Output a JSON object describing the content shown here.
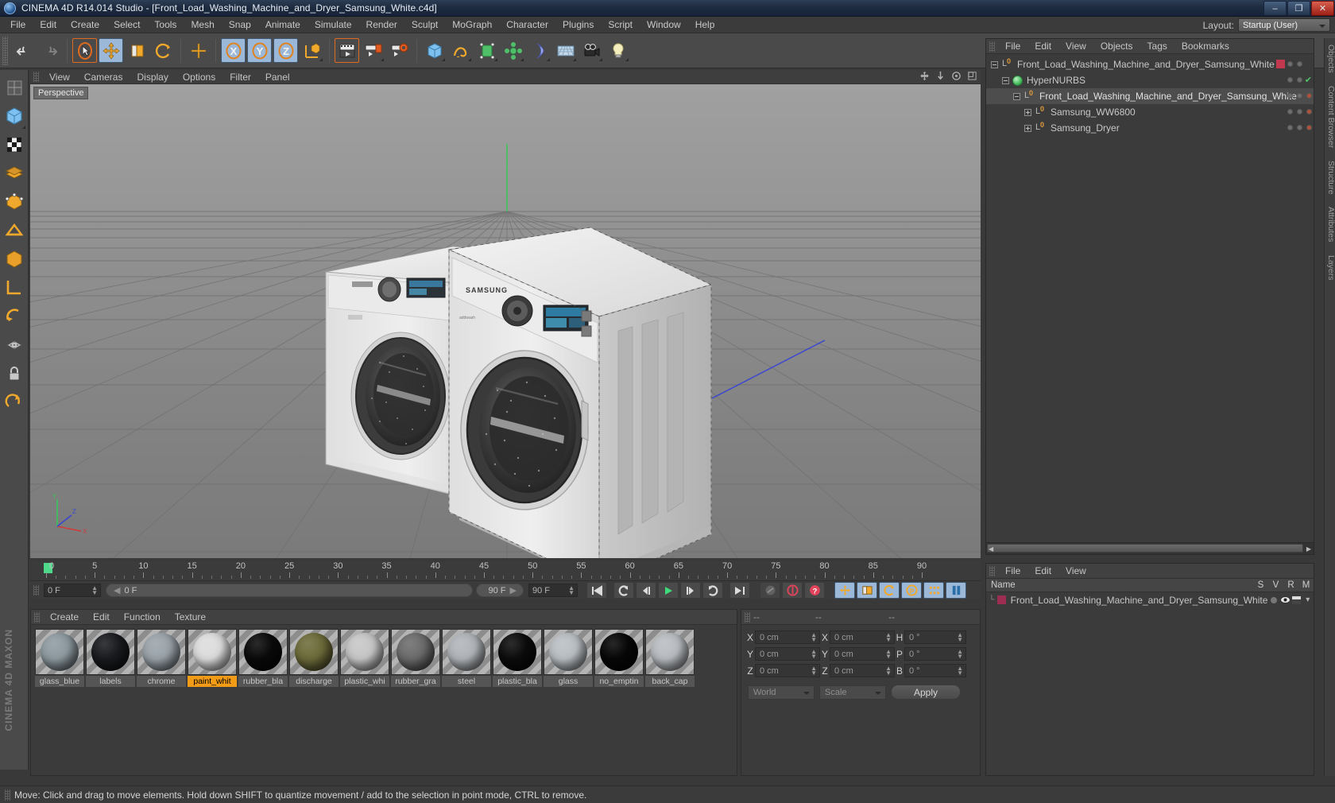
{
  "window": {
    "title": "CINEMA 4D R14.014 Studio - [Front_Load_Washing_Machine_and_Dryer_Samsung_White.c4d]",
    "minimize": "–",
    "maximize": "❐",
    "close": "✕"
  },
  "menubar": {
    "items": [
      "File",
      "Edit",
      "Create",
      "Select",
      "Tools",
      "Mesh",
      "Snap",
      "Animate",
      "Simulate",
      "Render",
      "Sculpt",
      "MoGraph",
      "Character",
      "Plugins",
      "Script",
      "Window",
      "Help"
    ],
    "layout_label": "Layout:",
    "layout_value": "Startup (User)"
  },
  "viewport": {
    "menu": [
      "View",
      "Cameras",
      "Display",
      "Options",
      "Filter",
      "Panel"
    ],
    "label": "Perspective"
  },
  "object_manager": {
    "menu": [
      "File",
      "Edit",
      "View",
      "Objects",
      "Tags",
      "Bookmarks"
    ],
    "items": [
      {
        "label": "Front_Load_Washing_Machine_and_Dryer_Samsung_White",
        "indent": 0,
        "icon": "null-object-icon",
        "expander": "minus",
        "selected": false
      },
      {
        "label": "HyperNURBS",
        "indent": 1,
        "icon": "hypernurbs-icon",
        "expander": "minus",
        "selected": false
      },
      {
        "label": "Front_Load_Washing_Machine_and_Dryer_Samsung_White",
        "indent": 2,
        "icon": "null-object-icon",
        "expander": "minus",
        "selected": true
      },
      {
        "label": "Samsung_WW6800",
        "indent": 3,
        "icon": "null-object-icon",
        "expander": "plus",
        "selected": false
      },
      {
        "label": "Samsung_Dryer",
        "indent": 3,
        "icon": "null-object-icon",
        "expander": "plus",
        "selected": false
      }
    ]
  },
  "timeline": {
    "ticks": [
      "0",
      "5",
      "10",
      "15",
      "20",
      "25",
      "30",
      "35",
      "40",
      "45",
      "50",
      "55",
      "60",
      "65",
      "70",
      "75",
      "80",
      "85",
      "90"
    ],
    "current_frame_field": "0 F",
    "start_field": "0 F",
    "preview_min": "0 F",
    "preview_max": "90 F",
    "end_field": "90 F",
    "playback_icons": [
      "goto-start-icon",
      "play-reverse-icon",
      "step-back-icon",
      "play-icon",
      "step-forward-icon",
      "loop-icon",
      "goto-end-icon",
      "record-auto-icon",
      "record-keyframe-icon",
      "keyframe-help-icon",
      "position-key-icon",
      "scale-key-icon",
      "rotation-key-icon",
      "param-key-icon",
      "pla-key-icon",
      "keyframe-selection-icon"
    ]
  },
  "material_manager": {
    "menu": [
      "Create",
      "Edit",
      "Function",
      "Texture"
    ],
    "materials": [
      {
        "name": "glass_blue",
        "color": "#8d9aa0",
        "active": false
      },
      {
        "name": "labels",
        "color": "#191b1e",
        "active": false
      },
      {
        "name": "chrome",
        "color": "#9aa3aa",
        "active": false
      },
      {
        "name": "paint_whit",
        "color": "#dcdcdc",
        "active": true
      },
      {
        "name": "rubber_bla",
        "color": "#0a0a0a",
        "active": false
      },
      {
        "name": "discharge",
        "color": "#6c6b3a",
        "active": false
      },
      {
        "name": "plastic_whi",
        "color": "#c6c6c6",
        "active": false
      },
      {
        "name": "rubber_gra",
        "color": "#6b6b6b",
        "active": false
      },
      {
        "name": "steel",
        "color": "#b0b4b8",
        "active": false
      },
      {
        "name": "plastic_bla",
        "color": "#0c0c0c",
        "active": false
      },
      {
        "name": "glass",
        "color": "#b9bec2",
        "active": false
      },
      {
        "name": "no_emptin",
        "color": "#070707",
        "active": false
      },
      {
        "name": "back_cap",
        "color": "#b8bcc0",
        "active": false
      }
    ]
  },
  "coordinates": {
    "header": [
      "--",
      "--",
      "--"
    ],
    "rows": [
      {
        "pos_axis": "X",
        "pos_value": "0 cm",
        "size_axis": "X",
        "size_value": "0 cm",
        "rot_axis": "H",
        "rot_value": "0 °"
      },
      {
        "pos_axis": "Y",
        "pos_value": "0 cm",
        "size_axis": "Y",
        "size_value": "0 cm",
        "rot_axis": "P",
        "rot_value": "0 °"
      },
      {
        "pos_axis": "Z",
        "pos_value": "0 cm",
        "size_axis": "Z",
        "size_value": "0 cm",
        "rot_axis": "B",
        "rot_value": "0 °"
      }
    ],
    "system": "World",
    "mode": "Scale",
    "apply": "Apply"
  },
  "layer_manager": {
    "menu": [
      "File",
      "Edit",
      "View"
    ],
    "columns": [
      "Name",
      "S",
      "V",
      "R",
      "M"
    ],
    "rows": [
      {
        "name": "Front_Load_Washing_Machine_and_Dryer_Samsung_White",
        "color": "#9e2d52"
      }
    ]
  },
  "right_tabs": [
    "Objects",
    "Content Browser",
    "Structure",
    "Attributes",
    "Layers"
  ],
  "status": {
    "message": "Move: Click and drag to move elements. Hold down SHIFT to quantize movement / add to the selection in point mode, CTRL to remove."
  },
  "toolbar": {
    "groups": [
      {
        "buttons": [
          {
            "icon": "undo-icon",
            "state": "normal"
          },
          {
            "icon": "redo-icon",
            "state": "disabled"
          }
        ]
      },
      {
        "buttons": [
          {
            "icon": "live-selection-icon",
            "state": "selected"
          },
          {
            "icon": "move-icon",
            "state": "on"
          },
          {
            "icon": "scale-icon",
            "state": "normal"
          },
          {
            "icon": "rotate-icon",
            "state": "normal"
          }
        ]
      },
      {
        "buttons": [
          {
            "icon": "plus-tool-icon",
            "state": "normal"
          }
        ]
      },
      {
        "buttons": [
          {
            "icon": "x-axis-icon",
            "state": "on"
          },
          {
            "icon": "y-axis-icon",
            "state": "on"
          },
          {
            "icon": "z-axis-icon",
            "state": "on"
          },
          {
            "icon": "world-object-axis-icon",
            "state": "normal"
          }
        ]
      },
      {
        "buttons": [
          {
            "icon": "render-view-icon",
            "state": "selected"
          },
          {
            "icon": "render-region-icon",
            "state": "normal"
          },
          {
            "icon": "render-settings-icon",
            "state": "normal"
          }
        ]
      },
      {
        "buttons": [
          {
            "icon": "cube-primitive-icon",
            "state": "normal"
          },
          {
            "icon": "spline-icon",
            "state": "normal"
          },
          {
            "icon": "nurbs-icon",
            "state": "normal"
          },
          {
            "icon": "array-icon",
            "state": "normal"
          },
          {
            "icon": "deformer-icon",
            "state": "normal"
          },
          {
            "icon": "floor-environment-icon",
            "state": "normal"
          },
          {
            "icon": "camera-icon",
            "state": "normal"
          },
          {
            "icon": "light-icon",
            "state": "normal"
          }
        ]
      }
    ]
  },
  "left_toolbar": {
    "buttons": [
      {
        "icon": "texture-axis-icon"
      },
      {
        "icon": "model-mode-icon"
      },
      {
        "icon": "texture-mode-icon"
      },
      {
        "icon": "polygon-mode-icon"
      },
      {
        "icon": "point-mode-icon"
      },
      {
        "icon": "edge-mode-icon"
      },
      {
        "icon": "object-axis-icon"
      },
      {
        "icon": "workplane-icon"
      },
      {
        "icon": "enable-axis-icon"
      },
      {
        "icon": "viewport-solo-icon"
      },
      {
        "icon": "lock-axis-icon"
      },
      {
        "icon": "quantize-icon"
      }
    ],
    "brand_top": "MAXON",
    "brand_bottom": "CINEMA 4D"
  }
}
